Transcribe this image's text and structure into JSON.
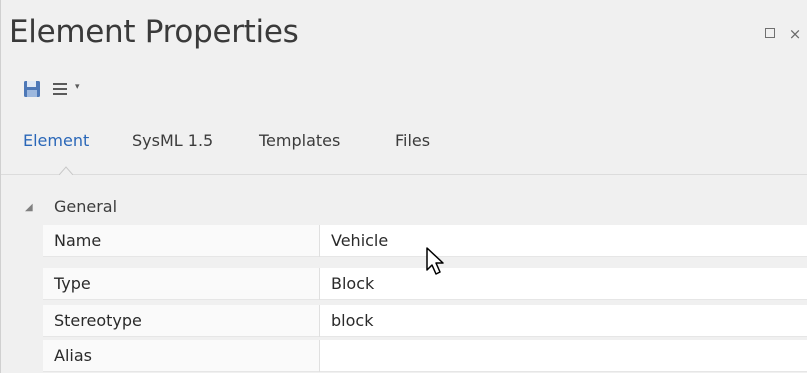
{
  "window": {
    "title": "Element Properties",
    "restore_icon": "restore-icon",
    "close_glyph": "×"
  },
  "toolbar": {
    "save_icon": "save-icon",
    "menu_icon": "hamburger-menu-icon",
    "dropdown_glyph": "▾"
  },
  "tabs": [
    {
      "label": "Element",
      "active": true
    },
    {
      "label": "SysML 1.5",
      "active": false
    },
    {
      "label": "Templates",
      "active": false
    },
    {
      "label": "Files",
      "active": false
    }
  ],
  "group": {
    "label": "General",
    "expanded_glyph": "◢"
  },
  "properties": [
    {
      "name": "Name",
      "value": "Vehicle"
    },
    {
      "name": "Type",
      "value": "Block"
    },
    {
      "name": "Stereotype",
      "value": "block"
    },
    {
      "name": "Alias",
      "value": ""
    }
  ],
  "colors": {
    "accent": "#2a67b8",
    "panel_bg": "#f0f0f0",
    "value_bg": "#ffffff"
  }
}
